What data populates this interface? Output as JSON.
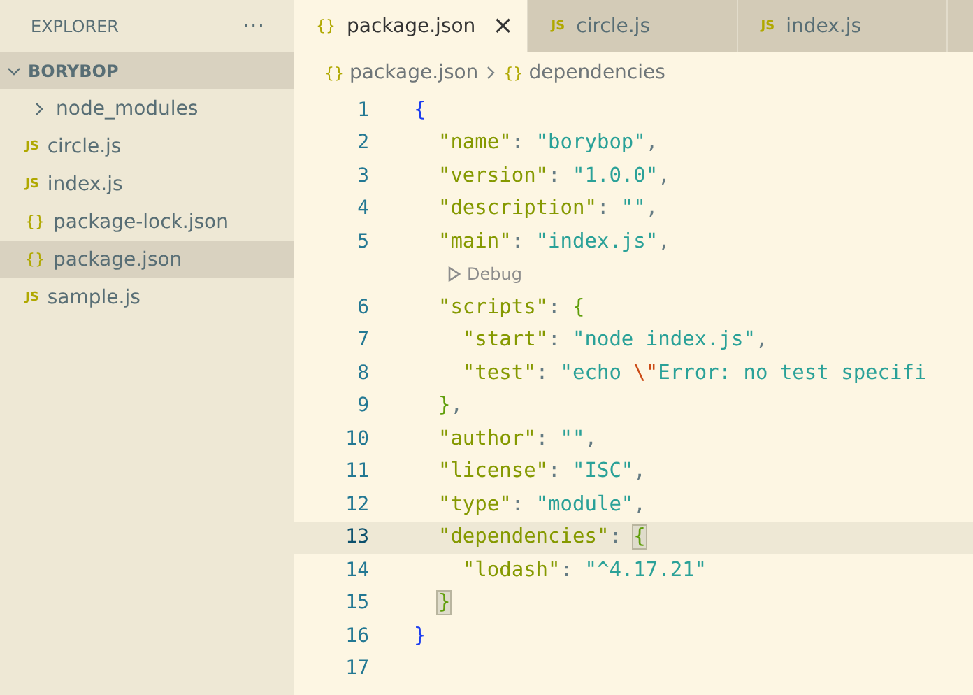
{
  "sidebar": {
    "title": "EXPLORER",
    "more": "···",
    "folder": {
      "label": "BORYBOP",
      "expanded": true,
      "children": [
        {
          "label": "node_modules",
          "kind": "folder",
          "expanded": false,
          "selected": false
        },
        {
          "label": "circle.js",
          "kind": "js",
          "icon": "JS",
          "selected": false
        },
        {
          "label": "index.js",
          "kind": "js",
          "icon": "JS",
          "selected": false
        },
        {
          "label": "package-lock.json",
          "kind": "json",
          "icon": "{}",
          "selected": false
        },
        {
          "label": "package.json",
          "kind": "json",
          "icon": "{}",
          "selected": true
        },
        {
          "label": "sample.js",
          "kind": "js",
          "icon": "JS",
          "selected": false
        }
      ]
    }
  },
  "tabs": [
    {
      "label": "package.json",
      "kind": "json",
      "icon": "{}",
      "selected": true,
      "close": "×"
    },
    {
      "label": "circle.js",
      "kind": "js",
      "icon": "JS",
      "selected": false
    },
    {
      "label": "index.js",
      "kind": "js",
      "icon": "JS",
      "selected": false
    }
  ],
  "breadcrumbs": [
    {
      "label": "package.json",
      "icon": "{}"
    },
    {
      "label": "dependencies",
      "icon": "{}"
    }
  ],
  "lines": [
    {
      "kind": "code",
      "number": "1",
      "highlighted": false,
      "tokens": [
        {
          "kind": "brace1",
          "text": "{"
        }
      ]
    },
    {
      "kind": "code",
      "number": "2",
      "highlighted": false,
      "tokens": [
        {
          "kind": "key",
          "text": "  \"name\""
        },
        {
          "kind": "punct",
          "text": ": "
        },
        {
          "kind": "string",
          "text": "\"borybop\""
        },
        {
          "kind": "punct",
          "text": ","
        }
      ]
    },
    {
      "kind": "code",
      "number": "3",
      "highlighted": false,
      "tokens": [
        {
          "kind": "key",
          "text": "  \"version\""
        },
        {
          "kind": "punct",
          "text": ": "
        },
        {
          "kind": "string",
          "text": "\"1.0.0\""
        },
        {
          "kind": "punct",
          "text": ","
        }
      ]
    },
    {
      "kind": "code",
      "number": "4",
      "highlighted": false,
      "tokens": [
        {
          "kind": "key",
          "text": "  \"description\""
        },
        {
          "kind": "punct",
          "text": ": "
        },
        {
          "kind": "string",
          "text": "\"\""
        },
        {
          "kind": "punct",
          "text": ","
        }
      ]
    },
    {
      "kind": "code",
      "number": "5",
      "highlighted": false,
      "tokens": [
        {
          "kind": "key",
          "text": "  \"main\""
        },
        {
          "kind": "punct",
          "text": ": "
        },
        {
          "kind": "string",
          "text": "\"index.js\""
        },
        {
          "kind": "punct",
          "text": ","
        }
      ]
    },
    {
      "kind": "codelens",
      "text": "Debug"
    },
    {
      "kind": "code",
      "number": "6",
      "highlighted": false,
      "tokens": [
        {
          "kind": "key",
          "text": "  \"scripts\""
        },
        {
          "kind": "punct",
          "text": ": "
        },
        {
          "kind": "brace2",
          "text": "{"
        }
      ]
    },
    {
      "kind": "code",
      "number": "7",
      "highlighted": false,
      "tokens": [
        {
          "kind": "key",
          "text": "    \"start\""
        },
        {
          "kind": "punct",
          "text": ": "
        },
        {
          "kind": "string",
          "text": "\"node index.js\""
        },
        {
          "kind": "punct",
          "text": ","
        }
      ]
    },
    {
      "kind": "code",
      "number": "8",
      "highlighted": false,
      "tokens": [
        {
          "kind": "key",
          "text": "    \"test\""
        },
        {
          "kind": "punct",
          "text": ": "
        },
        {
          "kind": "string",
          "text": "\"echo "
        },
        {
          "kind": "escape",
          "text": "\\\""
        },
        {
          "kind": "string",
          "text": "Error: no test specifi"
        }
      ]
    },
    {
      "kind": "code",
      "number": "9",
      "highlighted": false,
      "tokens": [
        {
          "kind": "brace2",
          "text": "  }"
        },
        {
          "kind": "punct",
          "text": ","
        }
      ]
    },
    {
      "kind": "code",
      "number": "10",
      "highlighted": false,
      "tokens": [
        {
          "kind": "key",
          "text": "  \"author\""
        },
        {
          "kind": "punct",
          "text": ": "
        },
        {
          "kind": "string",
          "text": "\"\""
        },
        {
          "kind": "punct",
          "text": ","
        }
      ]
    },
    {
      "kind": "code",
      "number": "11",
      "highlighted": false,
      "tokens": [
        {
          "kind": "key",
          "text": "  \"license\""
        },
        {
          "kind": "punct",
          "text": ": "
        },
        {
          "kind": "string",
          "text": "\"ISC\""
        },
        {
          "kind": "punct",
          "text": ","
        }
      ]
    },
    {
      "kind": "code",
      "number": "12",
      "highlighted": false,
      "tokens": [
        {
          "kind": "key",
          "text": "  \"type\""
        },
        {
          "kind": "punct",
          "text": ": "
        },
        {
          "kind": "string",
          "text": "\"module\""
        },
        {
          "kind": "punct",
          "text": ","
        }
      ]
    },
    {
      "kind": "code",
      "number": "13",
      "highlighted": true,
      "tokens": [
        {
          "kind": "key",
          "text": "  \"dependencies\""
        },
        {
          "kind": "punct",
          "text": ": "
        },
        {
          "kind": "match",
          "text": "{"
        }
      ]
    },
    {
      "kind": "code",
      "number": "14",
      "highlighted": false,
      "tokens": [
        {
          "kind": "key",
          "text": "    \"lodash\""
        },
        {
          "kind": "punct",
          "text": ": "
        },
        {
          "kind": "string",
          "text": "\"^4.17.21\""
        }
      ]
    },
    {
      "kind": "code",
      "number": "15",
      "highlighted": false,
      "tokens": [
        {
          "kind": "closematch",
          "text": "}"
        }
      ]
    },
    {
      "kind": "code",
      "number": "16",
      "highlighted": false,
      "tokens": [
        {
          "kind": "brace1",
          "text": "}"
        }
      ]
    },
    {
      "kind": "code",
      "number": "17",
      "highlighted": false
    }
  ]
}
